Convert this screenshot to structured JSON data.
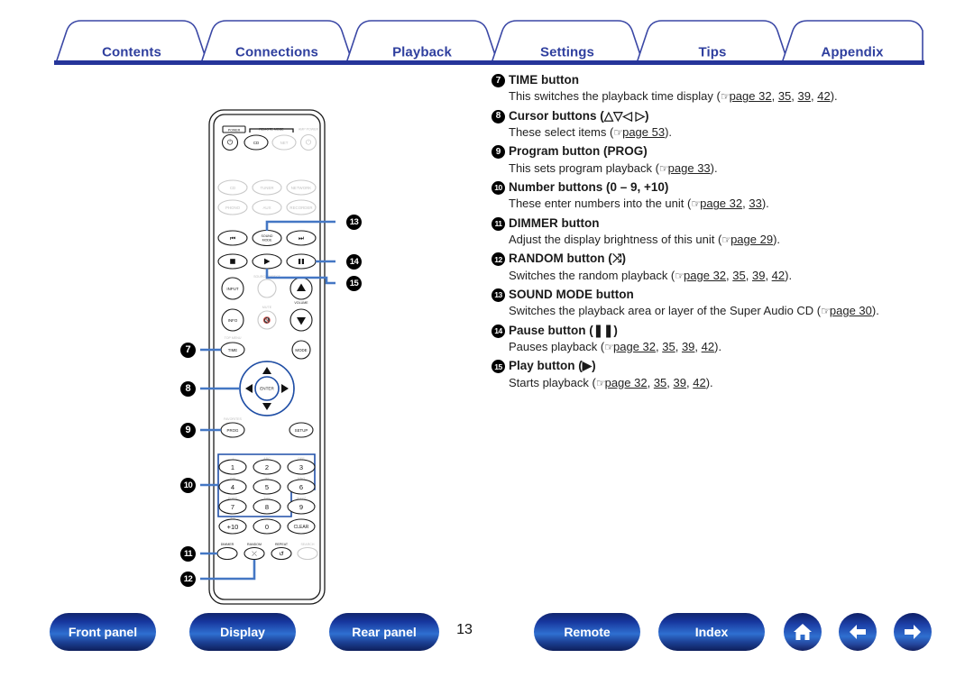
{
  "tabs": [
    {
      "label": "Contents"
    },
    {
      "label": "Connections"
    },
    {
      "label": "Playback"
    },
    {
      "label": "Settings"
    },
    {
      "label": "Tips"
    },
    {
      "label": "Appendix"
    }
  ],
  "entries": [
    {
      "num": "7",
      "title": "TIME button",
      "body_parts": [
        {
          "t": "text",
          "v": "This switches the playback time display ("
        },
        {
          "t": "hand"
        },
        {
          "t": "link",
          "v": "page 32"
        },
        {
          "t": "text",
          "v": ", "
        },
        {
          "t": "link",
          "v": "35"
        },
        {
          "t": "text",
          "v": ", "
        },
        {
          "t": "link",
          "v": "39"
        },
        {
          "t": "text",
          "v": ", "
        },
        {
          "t": "link",
          "v": "42"
        },
        {
          "t": "text",
          "v": ")."
        }
      ]
    },
    {
      "num": "8",
      "title": "Cursor buttons (△▽◁ ▷)",
      "body_parts": [
        {
          "t": "text",
          "v": "These select items ("
        },
        {
          "t": "hand"
        },
        {
          "t": "link",
          "v": "page 53"
        },
        {
          "t": "text",
          "v": ")."
        }
      ]
    },
    {
      "num": "9",
      "title": "Program button (PROG)",
      "body_parts": [
        {
          "t": "text",
          "v": "This sets program playback ("
        },
        {
          "t": "hand"
        },
        {
          "t": "link",
          "v": "page 33"
        },
        {
          "t": "text",
          "v": ")."
        }
      ]
    },
    {
      "num": "10",
      "title": "Number buttons (0 – 9, +10)",
      "body_parts": [
        {
          "t": "text",
          "v": "These enter numbers into the unit ("
        },
        {
          "t": "hand"
        },
        {
          "t": "link",
          "v": "page 32"
        },
        {
          "t": "text",
          "v": ", "
        },
        {
          "t": "link",
          "v": "33"
        },
        {
          "t": "text",
          "v": ")."
        }
      ]
    },
    {
      "num": "11",
      "title": "DIMMER button",
      "body_parts": [
        {
          "t": "text",
          "v": "Adjust the display brightness of this unit ("
        },
        {
          "t": "hand"
        },
        {
          "t": "link",
          "v": "page 29"
        },
        {
          "t": "text",
          "v": ")."
        }
      ]
    },
    {
      "num": "12",
      "title": "RANDOM button (⤨)",
      "body_parts": [
        {
          "t": "text",
          "v": "Switches the random playback ("
        },
        {
          "t": "hand"
        },
        {
          "t": "link",
          "v": "page 32"
        },
        {
          "t": "text",
          "v": ", "
        },
        {
          "t": "link",
          "v": "35"
        },
        {
          "t": "text",
          "v": ", "
        },
        {
          "t": "link",
          "v": "39"
        },
        {
          "t": "text",
          "v": ", "
        },
        {
          "t": "link",
          "v": "42"
        },
        {
          "t": "text",
          "v": ")."
        }
      ]
    },
    {
      "num": "13",
      "title": "SOUND MODE button",
      "body_parts": [
        {
          "t": "text",
          "v": "Switches the playback area or layer of the Super Audio CD ("
        },
        {
          "t": "hand"
        },
        {
          "t": "link",
          "v": "page 30"
        },
        {
          "t": "text",
          "v": ")."
        }
      ]
    },
    {
      "num": "14",
      "title": "Pause button (❚❚)",
      "body_parts": [
        {
          "t": "text",
          "v": "Pauses playback ("
        },
        {
          "t": "hand"
        },
        {
          "t": "link",
          "v": "page 32"
        },
        {
          "t": "text",
          "v": ", "
        },
        {
          "t": "link",
          "v": "35"
        },
        {
          "t": "text",
          "v": ", "
        },
        {
          "t": "link",
          "v": "39"
        },
        {
          "t": "text",
          "v": ", "
        },
        {
          "t": "link",
          "v": "42"
        },
        {
          "t": "text",
          "v": ")."
        }
      ]
    },
    {
      "num": "15",
      "title": "Play button (▶)",
      "body_parts": [
        {
          "t": "text",
          "v": "Starts playback ("
        },
        {
          "t": "hand"
        },
        {
          "t": "link",
          "v": "page 32"
        },
        {
          "t": "text",
          "v": ", "
        },
        {
          "t": "link",
          "v": "35"
        },
        {
          "t": "text",
          "v": ", "
        },
        {
          "t": "link",
          "v": "39"
        },
        {
          "t": "text",
          "v": ", "
        },
        {
          "t": "link",
          "v": "42"
        },
        {
          "t": "text",
          "v": ")."
        }
      ]
    }
  ],
  "callouts": {
    "left": [
      "7",
      "8",
      "9",
      "10",
      "11",
      "12"
    ],
    "right": [
      "13",
      "14",
      "15"
    ]
  },
  "remote": {
    "power_label": "POWER",
    "remote_mode_label": "REMOTE MODE",
    "amp_power_label": "AMP POWER",
    "mode_buttons": [
      "CD",
      "NET"
    ],
    "source_buttons": [
      "CD",
      "TUNER",
      "NETWORK",
      "PHONO",
      "AUX",
      "RECORDER"
    ],
    "transport": {
      "prev": "⏮",
      "sound_mode": "SOUND MODE",
      "next": "⏭",
      "stop": "■",
      "play": "▶",
      "pause": "❚❚"
    },
    "input_label": "INPUT",
    "info_label": "INFO",
    "source_direct_label": "SOURCE DIRECT",
    "mute_label": "MUTE",
    "volume_label": "VOLUME",
    "top_menu_label": "TOP MENU",
    "time_label": "TIME",
    "mode_label": "MODE",
    "enter_label": "ENTER",
    "favorites_label": "FAVORITES",
    "prog_label": "PROG",
    "setup_label": "SETUP",
    "numbers": [
      {
        "key": "1",
        "alpha": "./"
      },
      {
        "key": "2",
        "alpha": "ABC"
      },
      {
        "key": "3",
        "alpha": "DEF"
      },
      {
        "key": "4",
        "alpha": "GHI"
      },
      {
        "key": "5",
        "alpha": "JKL"
      },
      {
        "key": "6",
        "alpha": "MNO"
      },
      {
        "key": "7",
        "alpha": "PQRS"
      },
      {
        "key": "8",
        "alpha": "TUV"
      },
      {
        "key": "9",
        "alpha": "WXYZ"
      },
      {
        "key": "+10",
        "alpha": "a/A"
      },
      {
        "key": "0",
        "alpha": "␣"
      },
      {
        "key": "CLEAR",
        "alpha": ""
      }
    ],
    "bottom_row": [
      "DIMMER",
      "RANDOM",
      "REPEAT",
      "SEARCH"
    ]
  },
  "footer": {
    "left_buttons": [
      {
        "label": "Front panel"
      },
      {
        "label": "Display"
      },
      {
        "label": "Rear panel"
      }
    ],
    "page_number": "13",
    "right_buttons": [
      {
        "label": "Remote"
      },
      {
        "label": "Index"
      }
    ],
    "icons": [
      {
        "name": "home-icon"
      },
      {
        "name": "arrow-left-icon"
      },
      {
        "name": "arrow-right-icon"
      }
    ]
  }
}
